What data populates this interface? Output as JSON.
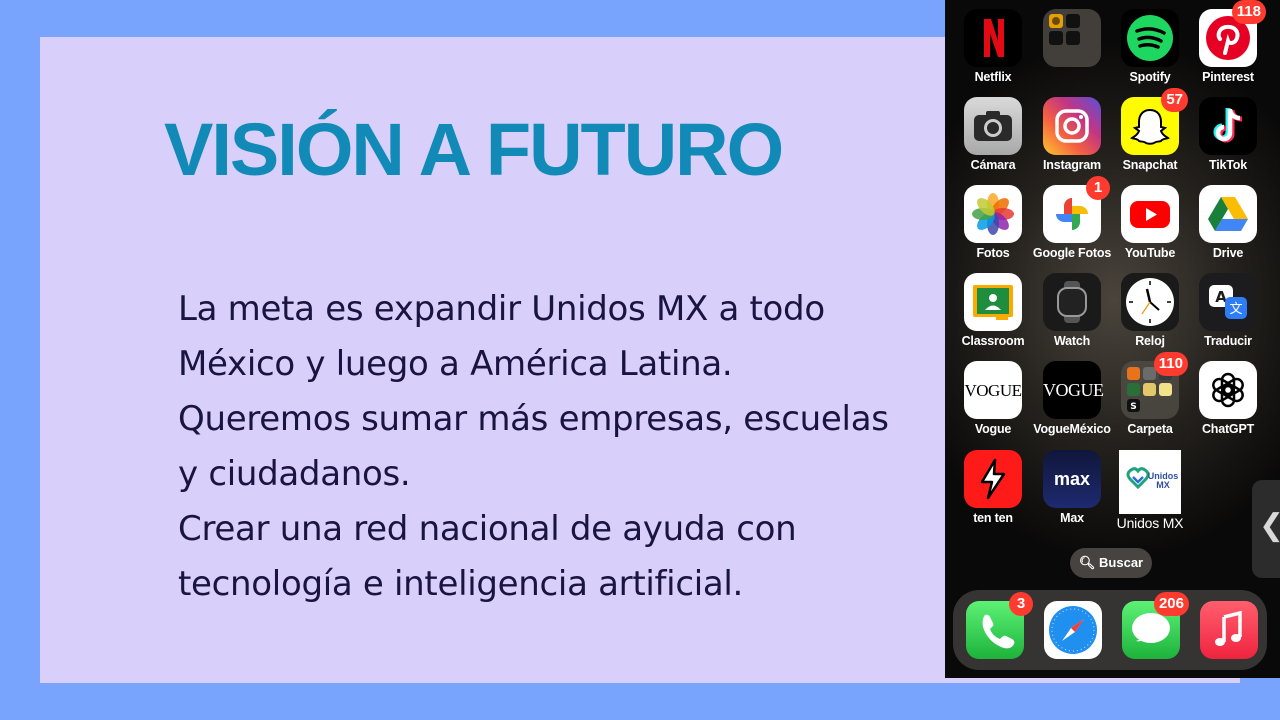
{
  "slide": {
    "title": "VISIÓN A FUTURO",
    "lines": [
      "La meta es expandir Unidos MX a todo",
      "México y luego a América Latina.",
      "Queremos sumar más empresas, escuelas",
      "y ciudadanos.",
      "Crear una red nacional de ayuda con",
      "tecnología e inteligencia artificial."
    ]
  },
  "phone": {
    "apps": [
      {
        "label": "Netflix",
        "icon": "netflix-icon"
      },
      {
        "label": "",
        "icon": "folder-icon"
      },
      {
        "label": "Spotify",
        "icon": "spotify-icon"
      },
      {
        "label": "Pinterest",
        "icon": "pinterest-icon",
        "badge": "118"
      },
      {
        "label": "Cámara",
        "icon": "camera-icon"
      },
      {
        "label": "Instagram",
        "icon": "instagram-icon"
      },
      {
        "label": "Snapchat",
        "icon": "snapchat-icon",
        "badge": "57"
      },
      {
        "label": "TikTok",
        "icon": "tiktok-icon"
      },
      {
        "label": "Fotos",
        "icon": "photos-icon"
      },
      {
        "label": "Google Fotos",
        "icon": "google-photos-icon",
        "badge": "1"
      },
      {
        "label": "YouTube",
        "icon": "youtube-icon"
      },
      {
        "label": "Drive",
        "icon": "drive-icon"
      },
      {
        "label": "Classroom",
        "icon": "classroom-icon"
      },
      {
        "label": "Watch",
        "icon": "watch-icon"
      },
      {
        "label": "Reloj",
        "icon": "clock-icon"
      },
      {
        "label": "Traducir",
        "icon": "translate-icon"
      },
      {
        "label": "Vogue",
        "icon": "vogue-icon",
        "text": "VOGUE"
      },
      {
        "label": "VogueMéxico",
        "icon": "vogue-mexico-icon",
        "text": "VOGUE"
      },
      {
        "label": "Carpeta",
        "icon": "folder-icon",
        "badge": "110"
      },
      {
        "label": "ChatGPT",
        "icon": "chatgpt-icon"
      },
      {
        "label": "ten ten",
        "icon": "tenten-icon"
      },
      {
        "label": "Max",
        "icon": "max-icon",
        "text": "max"
      },
      {
        "label": "Unidos MX",
        "icon": "unidos-mx-icon",
        "text": "Unidos MX"
      }
    ],
    "search_label": "Buscar",
    "dock": [
      {
        "label": "Teléfono",
        "icon": "phone-icon",
        "badge": "3"
      },
      {
        "label": "Safari",
        "icon": "safari-icon"
      },
      {
        "label": "Mensajes",
        "icon": "messages-icon",
        "badge": "206"
      },
      {
        "label": "Música",
        "icon": "music-icon"
      }
    ]
  }
}
